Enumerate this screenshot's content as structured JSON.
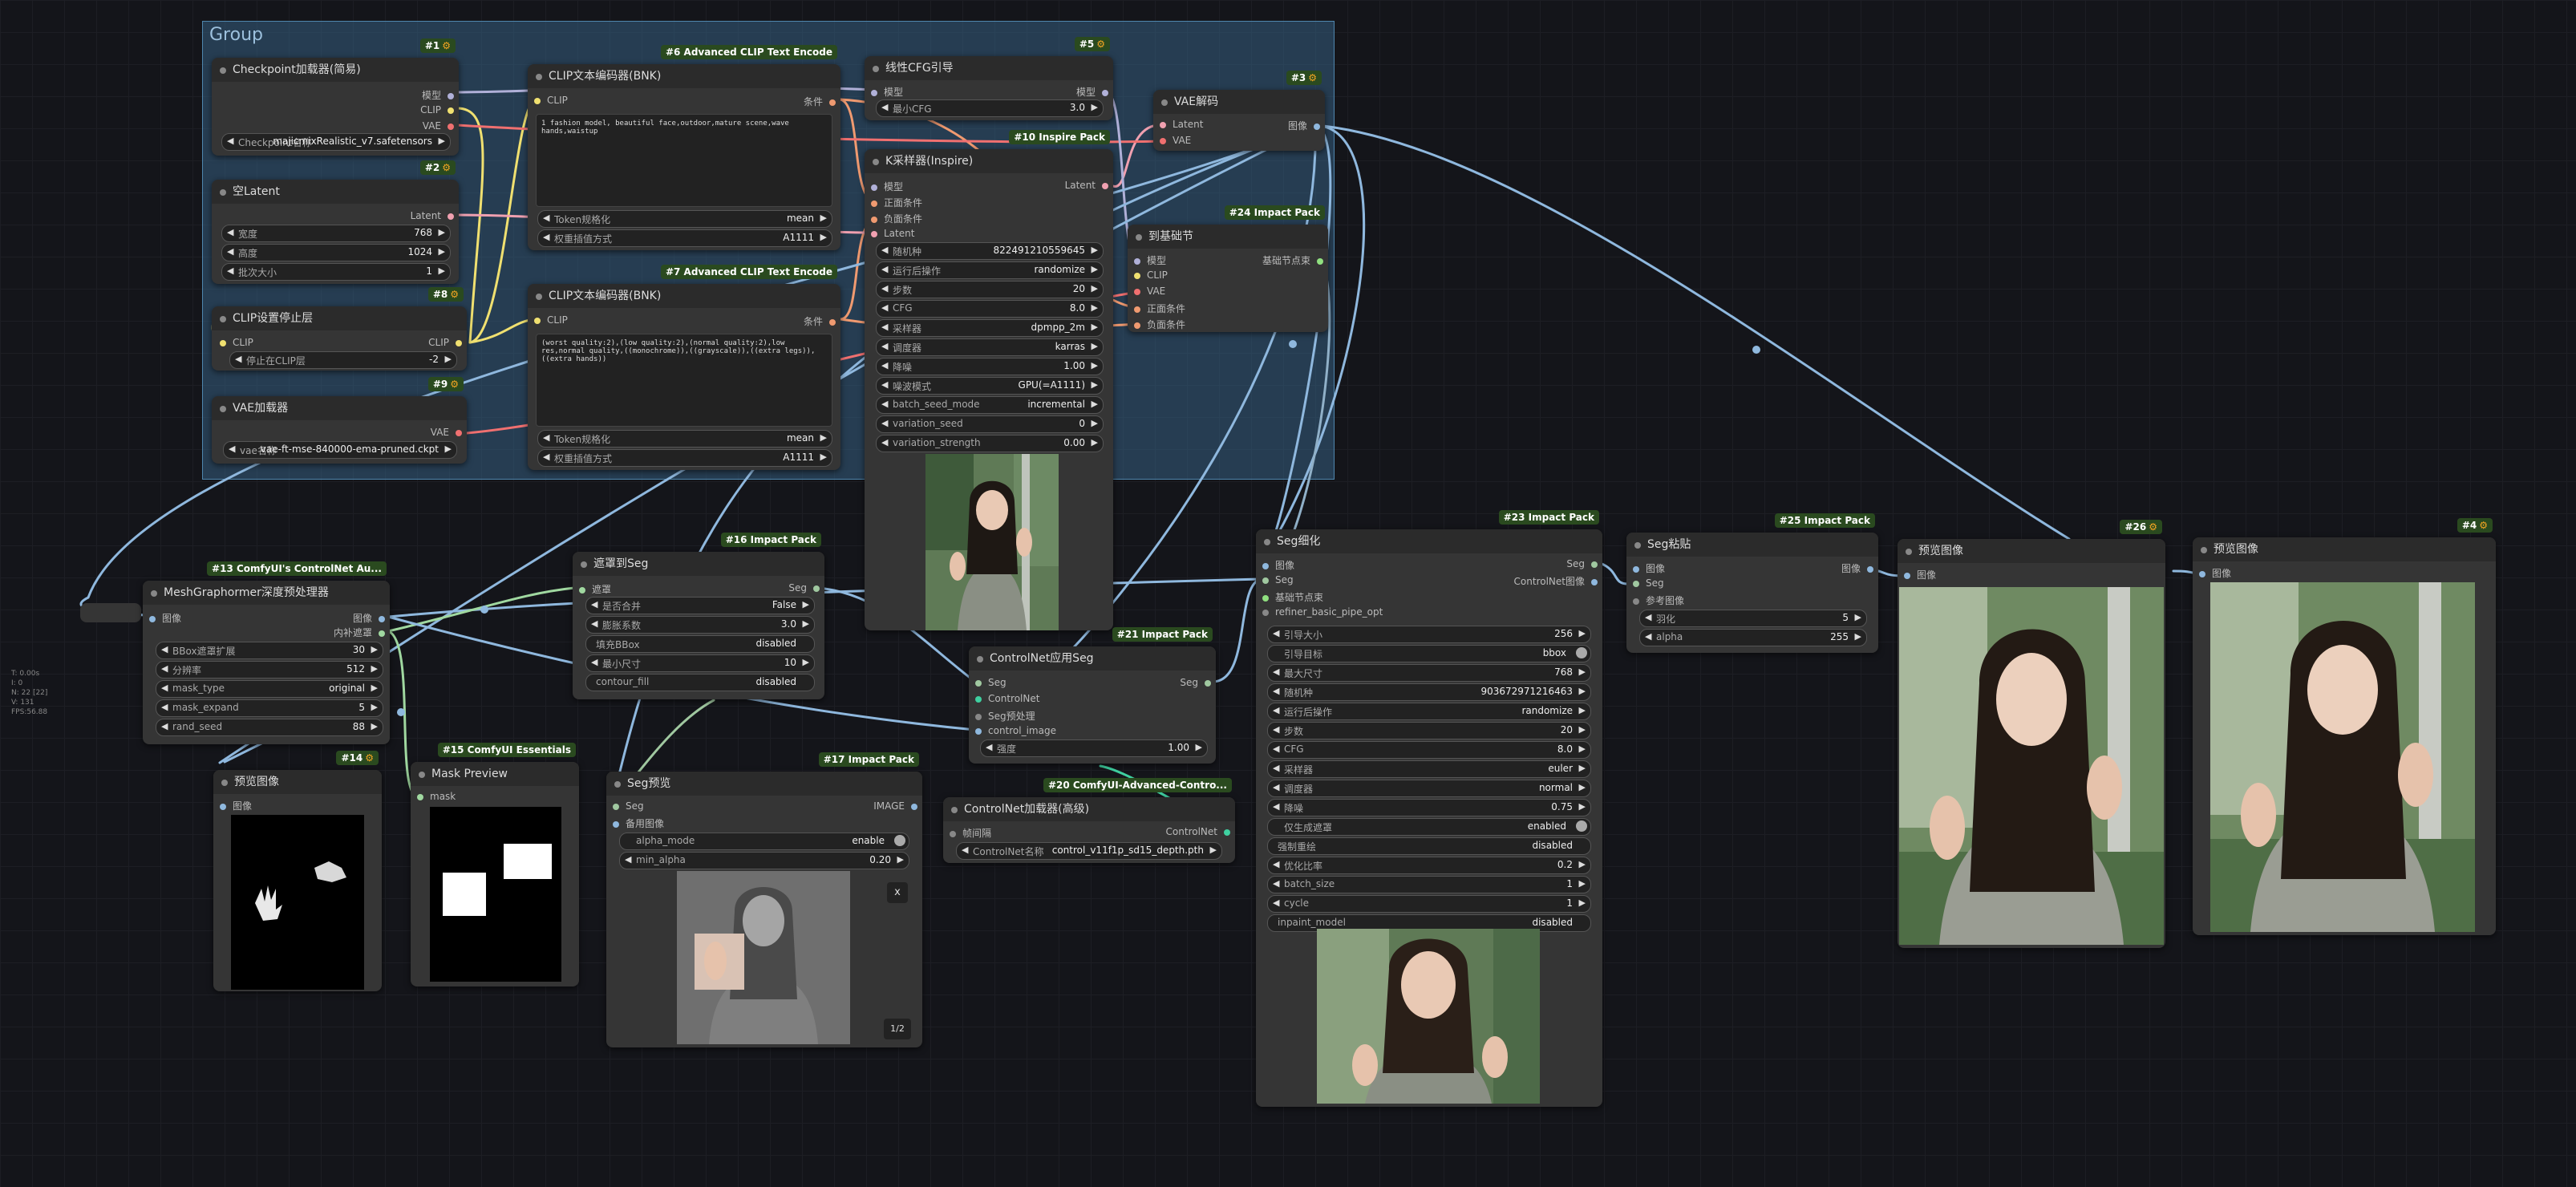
{
  "group": {
    "title": "Group"
  },
  "debug": {
    "lines": [
      "T: 0.00s",
      "I: 0",
      "N: 22 [22]",
      "V: 131",
      "FPS:56.88"
    ]
  },
  "colors": {
    "canvas": "#14151a",
    "node": "#353535",
    "header": "#2b2b2b",
    "group": "#3c6e96",
    "badge": "#2a4a1f",
    "wire_clip": "#f0e070",
    "wire_image": "#8fb8de",
    "wire_latent": "#f0a0b0",
    "wire_control": "#3fd0a0"
  },
  "nodes": {
    "ckpt": {
      "title": "Checkpoint加载器(简易)",
      "badge": "#1",
      "out_model": "模型",
      "out_clip": "CLIP",
      "out_vae": "VAE",
      "w_ckpt_label": "Checkpoint名称",
      "w_ckpt": "majicmixRealistic_v7.safetensors"
    },
    "latent": {
      "title": "空Latent",
      "badge": "#2",
      "out": "Latent",
      "w_w_label": "宽度",
      "w_w": "768",
      "w_h_label": "高度",
      "w_h": "1024",
      "w_b_label": "批次大小",
      "w_b": "1"
    },
    "clipskip": {
      "title": "CLIP设置停止层",
      "badge": "#8",
      "in_clip": "CLIP",
      "out_clip": "CLIP",
      "w_label": "停止在CLIP层",
      "w_val": "-2"
    },
    "vaeload": {
      "title": "VAE加载器",
      "badge": "#9",
      "out": "VAE",
      "w_label": "vae名称",
      "w_val": "vae-ft-mse-840000-ema-pruned.ckpt"
    },
    "clip6": {
      "title": "CLIP文本编码器(BNK)",
      "badge": "#6 Advanced CLIP Text Encode",
      "in_clip": "CLIP",
      "out": "条件",
      "text": "1 fashion model, beautiful face,outdoor,mature scene,wave hands,waistup",
      "w1_label": "Token规格化",
      "w1": "mean",
      "w2_label": "权重插值方式",
      "w2": "A1111"
    },
    "clip7": {
      "title": "CLIP文本编码器(BNK)",
      "badge": "#7 Advanced CLIP Text Encode",
      "in_clip": "CLIP",
      "out": "条件",
      "text": "(worst quality:2),(low quality:2),(normal quality:2),low res,normal quality,((monochrome)),((grayscale)),((extra legs)),((extra hands))",
      "w1_label": "Token规格化",
      "w1": "mean",
      "w2_label": "权重插值方式",
      "w2": "A1111"
    },
    "cfg": {
      "title": "线性CFG引导",
      "badge": "#5",
      "in_model": "模型",
      "out_model": "模型",
      "w_label": "最小CFG",
      "w_val": "3.0"
    },
    "ksampler": {
      "title": "K采样器(Inspire)",
      "badge": "#10 Inspire Pack",
      "in": [
        "模型",
        "正面条件",
        "负面条件",
        "Latent"
      ],
      "out": "Latent",
      "widgets": [
        [
          "随机种",
          "822491210559645"
        ],
        [
          "运行后操作",
          "randomize"
        ],
        [
          "步数",
          "20"
        ],
        [
          "CFG",
          "8.0"
        ],
        [
          "采样器",
          "dpmpp_2m"
        ],
        [
          "调度器",
          "karras"
        ],
        [
          "降噪",
          "1.00"
        ],
        [
          "噪波模式",
          "GPU(=A1111)"
        ],
        [
          "batch_seed_mode",
          "incremental"
        ],
        [
          "variation_seed",
          "0"
        ],
        [
          "variation_strength",
          "0.00"
        ]
      ]
    },
    "vaedecode": {
      "title": "VAE解码",
      "badge": "#3",
      "in": [
        "Latent",
        "VAE"
      ],
      "out": "图像"
    },
    "tobasic": {
      "title": "到基础节",
      "badge": "#24 Impact Pack",
      "in": [
        "模型",
        "CLIP",
        "VAE",
        "正面条件",
        "负面条件"
      ],
      "out": "基础节点束"
    },
    "meshgraph": {
      "title": "MeshGraphormer深度预处理器",
      "badge": "#13 ComfyUI's ControlNet Au...",
      "in": "图像",
      "out1": "图像",
      "out2": "内补遮罩",
      "widgets": [
        [
          "BBox遮罩扩展",
          "30"
        ],
        [
          "分辨率",
          "512"
        ],
        [
          "mask_type",
          "original"
        ],
        [
          "mask_expand",
          "5"
        ],
        [
          "rand_seed",
          "88"
        ]
      ]
    },
    "mask2seg": {
      "title": "遮罩到Seg",
      "badge": "#16 Impact Pack",
      "in": "遮罩",
      "out": "Seg",
      "widgets": [
        [
          "是否合并",
          "False"
        ],
        [
          "膨胀系数",
          "3.0"
        ],
        [
          "填充BBox",
          "disabled"
        ],
        [
          "最小尺寸",
          "10"
        ],
        [
          "contour_fill",
          "disabled"
        ]
      ]
    },
    "cnapply": {
      "title": "ControlNet应用Seg",
      "badge": "#21 Impact Pack",
      "in": [
        "Seg",
        "ControlNet",
        "Seg预处理",
        "control_image"
      ],
      "out": "Seg",
      "w_label": "强度",
      "w_val": "1.00"
    },
    "cnload": {
      "title": "ControlNet加载器(高级)",
      "badge": "#20 ComfyUI-Advanced-Contro...",
      "in": "帧间隔",
      "out": "ControlNet",
      "w_label": "ControlNet名称",
      "w_val": "control_v11f1p_sd15_depth.pth"
    },
    "preview14": {
      "title": "预览图像",
      "badge": "#14",
      "in": "图像"
    },
    "maskprev": {
      "title": "Mask Preview",
      "badge": "#15 ComfyUI Essentials",
      "in": "mask"
    },
    "segprev": {
      "title": "Seg预览",
      "badge": "#17 Impact Pack",
      "in1": "Seg",
      "in2": "备用图像",
      "out": "IMAGE",
      "w1_label": "alpha_mode",
      "w1": "enable",
      "w2_label": "min_alpha",
      "w2": "0.20",
      "btn_x": "x",
      "pager": "1/2"
    },
    "detailer": {
      "title": "Seg细化",
      "badge": "#23 Impact Pack",
      "in": [
        "图像",
        "Seg",
        "基础节点束",
        "refiner_basic_pipe_opt"
      ],
      "out1": "Seg",
      "out2": "ControlNet图像",
      "widgets": [
        [
          "引导大小",
          "256",
          "n"
        ],
        [
          "引导目标",
          "bbox",
          "t"
        ],
        [
          "最大尺寸",
          "768",
          "n"
        ],
        [
          "随机种",
          "903672971216463",
          "n"
        ],
        [
          "运行后操作",
          "randomize",
          "n"
        ],
        [
          "步数",
          "20",
          "n"
        ],
        [
          "CFG",
          "8.0",
          "n"
        ],
        [
          "采样器",
          "euler",
          "n"
        ],
        [
          "调度器",
          "normal",
          "n"
        ],
        [
          "降噪",
          "0.75",
          "n"
        ],
        [
          "仅生成遮罩",
          "enabled",
          "t"
        ],
        [
          "强制重绘",
          "disabled",
          "p"
        ],
        [
          "优化比率",
          "0.2",
          "n"
        ],
        [
          "batch_size",
          "1",
          "n"
        ],
        [
          "cycle",
          "1",
          "n"
        ],
        [
          "inpaint_model",
          "disabled",
          "p"
        ]
      ]
    },
    "segpaste": {
      "title": "Seg粘贴",
      "badge": "#25 Impact Pack",
      "in": [
        "图像",
        "Seg",
        "参考图像"
      ],
      "out": "图像",
      "w1_label": "羽化",
      "w1": "5",
      "w2_label": "alpha",
      "w2": "255"
    },
    "preview26": {
      "title": "预览图像",
      "badge": "#26",
      "in": "图像"
    },
    "preview4": {
      "title": "预览图像",
      "badge": "#4",
      "in": "图像"
    }
  }
}
